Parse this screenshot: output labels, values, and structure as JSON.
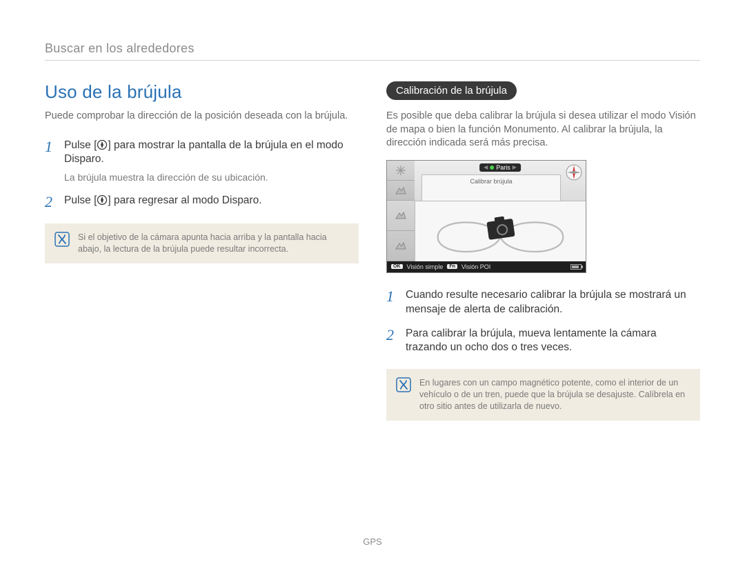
{
  "breadcrumb": "Buscar en los alrededores",
  "left": {
    "title": "Uso de la brújula",
    "intro": "Puede comprobar la dirección de la posición deseada con la brújula.",
    "steps": [
      {
        "num": "1",
        "pre": "Pulse [",
        "post": "] para mostrar la pantalla de la brújula en el modo Disparo.",
        "sub": "La brújula muestra la dirección de su ubicación."
      },
      {
        "num": "2",
        "pre": "Pulse [",
        "post": "] para regresar al modo Disparo.",
        "sub": ""
      }
    ],
    "note": "Si el objetivo de la cámara apunta hacia arriba y la pantalla hacia abajo, la lectura de la brújula puede resultar incorrecta."
  },
  "right": {
    "pill": "Calibración de la brújula",
    "intro": "Es posible que deba calibrar la brújula si desea utilizar el modo Visión de mapa o bien la función Monumento. Al calibrar la brújula, la dirección indicada será más precisa.",
    "screenshot": {
      "chip_label": "Paris",
      "panel_label": "Calibrar brújula",
      "footer_left_key": "OK",
      "footer_left_label": "Visión simple",
      "footer_right_key": "Fn",
      "footer_right_label": "Visión POI"
    },
    "steps": [
      {
        "num": "1",
        "text": "Cuando resulte necesario calibrar la brújula se mostrará un mensaje de alerta de calibración."
      },
      {
        "num": "2",
        "text": "Para calibrar la brújula, mueva lentamente la cámara trazando un ocho dos o tres veces."
      }
    ],
    "note": "En lugares con un campo magnético potente, como el interior de un vehículo o de un tren, puede que la brújula se desajuste. Calíbrela en otro sitio antes de utilizarla de nuevo."
  },
  "footer": "GPS"
}
